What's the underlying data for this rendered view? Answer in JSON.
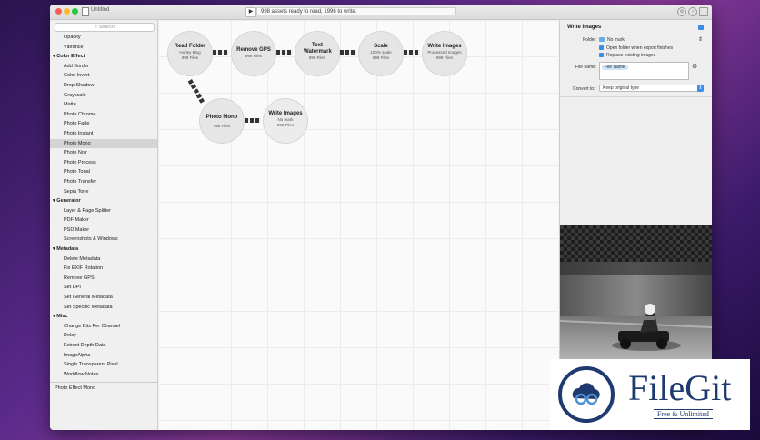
{
  "window": {
    "title": "Untitled",
    "status": "998 assets ready to read, 1996 to write.",
    "run_glyph": "▶"
  },
  "sidebar": {
    "search_placeholder": "Search",
    "rows": [
      {
        "label": "Opacity",
        "type": "item"
      },
      {
        "label": "Vibrance",
        "type": "item"
      },
      {
        "label": "Color Effect",
        "type": "cat"
      },
      {
        "label": "Add Border",
        "type": "item"
      },
      {
        "label": "Color Invert",
        "type": "item"
      },
      {
        "label": "Drop Shadow",
        "type": "item"
      },
      {
        "label": "Grayscale",
        "type": "item"
      },
      {
        "label": "Matte",
        "type": "item"
      },
      {
        "label": "Photo Chrome",
        "type": "item"
      },
      {
        "label": "Photo Fade",
        "type": "item"
      },
      {
        "label": "Photo Instant",
        "type": "item"
      },
      {
        "label": "Photo Mono",
        "type": "item",
        "selected": true
      },
      {
        "label": "Photo Noir",
        "type": "item"
      },
      {
        "label": "Photo Process",
        "type": "item"
      },
      {
        "label": "Photo Tonal",
        "type": "item"
      },
      {
        "label": "Photo Transfer",
        "type": "item"
      },
      {
        "label": "Sepia Tone",
        "type": "item"
      },
      {
        "label": "Generator",
        "type": "cat"
      },
      {
        "label": "Layer & Page Splitter",
        "type": "item"
      },
      {
        "label": "PDF Maker",
        "type": "item"
      },
      {
        "label": "PSD Maker",
        "type": "item"
      },
      {
        "label": "Screenshots & Windows",
        "type": "item"
      },
      {
        "label": "Metadata",
        "type": "cat"
      },
      {
        "label": "Delete Metadata",
        "type": "item"
      },
      {
        "label": "Fix EXIF Rotation",
        "type": "item"
      },
      {
        "label": "Remove GPS",
        "type": "item"
      },
      {
        "label": "Set DPI",
        "type": "item"
      },
      {
        "label": "Set General Metadata",
        "type": "item"
      },
      {
        "label": "Set Specific Metadata",
        "type": "item"
      },
      {
        "label": "Misc",
        "type": "cat"
      },
      {
        "label": "Change Bits Per Channel",
        "type": "item"
      },
      {
        "label": "Delay",
        "type": "item"
      },
      {
        "label": "Extract Depth Data",
        "type": "item"
      },
      {
        "label": "ImageAlpha",
        "type": "item"
      },
      {
        "label": "Single Transparent Pixel",
        "type": "item"
      },
      {
        "label": "Workflow Notes",
        "type": "item"
      }
    ],
    "footer_text": "Photo Effect Mono"
  },
  "nodes": [
    {
      "id": "read-folder",
      "title": "Read Folder",
      "sub1": "Hurley Blog",
      "sub2": "998 Files"
    },
    {
      "id": "remove-gps",
      "title": "Remove GPS",
      "sub1": "",
      "sub2": "998 Files"
    },
    {
      "id": "text-watermark",
      "title": "Text Watermark",
      "sub1": "",
      "sub2": "998 Files"
    },
    {
      "id": "scale",
      "title": "Scale",
      "sub1": "100% scale",
      "sub2": "998 Files"
    },
    {
      "id": "write-images-1",
      "title": "Write Images",
      "sub1": "Processed Images",
      "sub2": "998 Files"
    },
    {
      "id": "photo-mono",
      "title": "Photo Mono",
      "sub1": "",
      "sub2": "998 Files"
    },
    {
      "id": "write-images-2",
      "title": "Write Images",
      "sub1": "No mark",
      "sub2": "998 Files"
    }
  ],
  "inspector": {
    "title": "Write Images",
    "folder_label": "Folder:",
    "folder_value": "No mark",
    "open_folder_label": "Open folder when export finishes",
    "replace_label": "Replace existing images",
    "filename_label": "File name:",
    "filename_token": "File Name",
    "convert_label": "Convert to:",
    "convert_value": "Keep original type"
  },
  "watermark": {
    "brand": "FileGit",
    "tagline": "Free & Unlimited"
  },
  "colors": {
    "accent": "#3a8ee6",
    "brand": "#1f3a6e"
  }
}
